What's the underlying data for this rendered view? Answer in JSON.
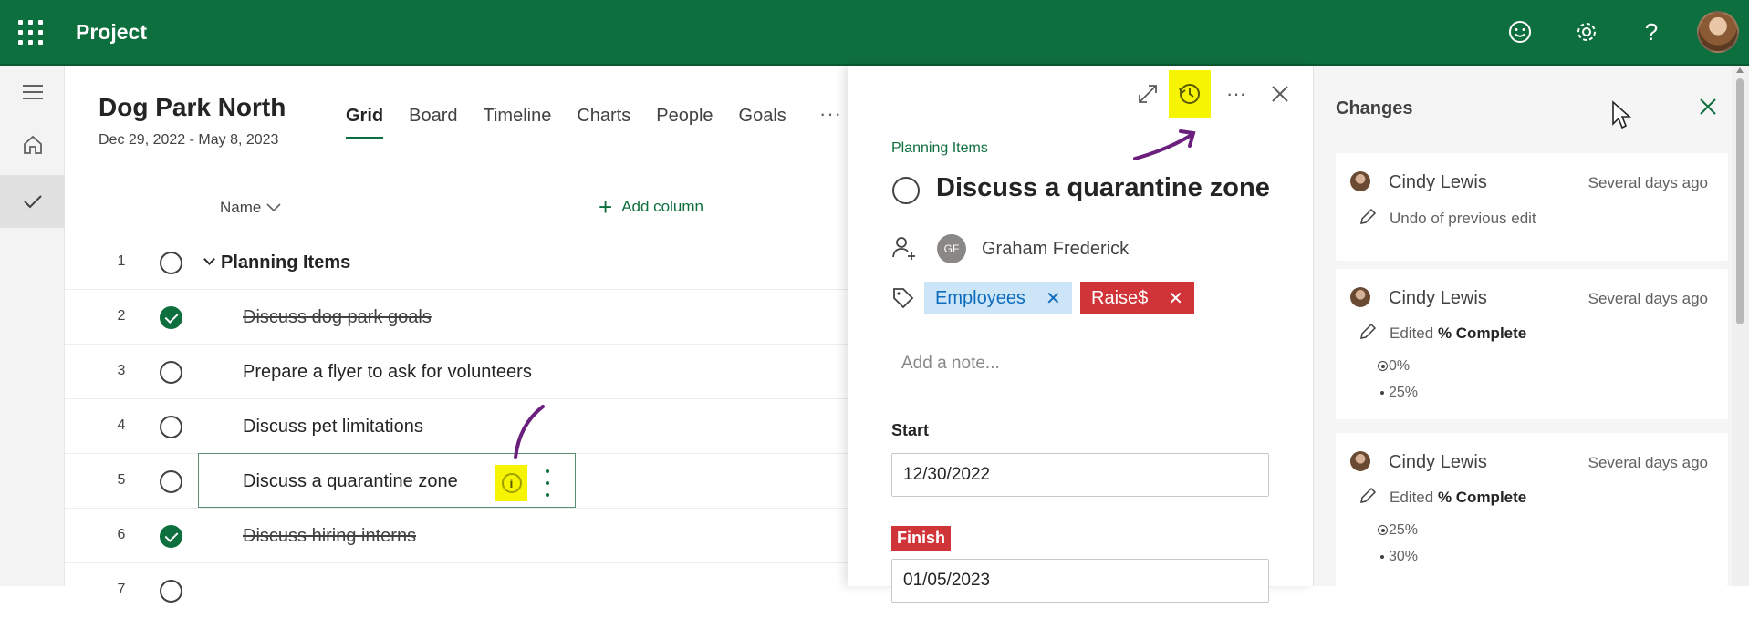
{
  "app": {
    "title": "Project"
  },
  "header_icons": [
    "smiley-icon",
    "gear-icon",
    "help-icon",
    "user-avatar"
  ],
  "help_glyph": "?",
  "project": {
    "name": "Dog Park North",
    "dates": "Dec 29, 2022 - May 8, 2023",
    "tabs": [
      {
        "label": "Grid",
        "active": true
      },
      {
        "label": "Board"
      },
      {
        "label": "Timeline"
      },
      {
        "label": "Charts"
      },
      {
        "label": "People"
      },
      {
        "label": "Goals"
      }
    ],
    "more": "···"
  },
  "grid": {
    "name_header": "Name",
    "add_column": "Add column",
    "rows": [
      {
        "num": "1",
        "task": "Planning Items",
        "bucket": true
      },
      {
        "num": "2",
        "task": "Discuss dog park goals",
        "done": true
      },
      {
        "num": "3",
        "task": "Prepare a flyer to ask for volunteers"
      },
      {
        "num": "4",
        "task": "Discuss pet limitations"
      },
      {
        "num": "5",
        "task": "Discuss a quarantine zone",
        "selected": true
      },
      {
        "num": "6",
        "task": "Discuss hiring interns",
        "done": true
      },
      {
        "num": "7",
        "task": ""
      }
    ]
  },
  "detail": {
    "bucket": "Planning Items",
    "title": "Discuss a quarantine zone",
    "assignee": {
      "initials": "GF",
      "name": "Graham Frederick"
    },
    "labels": [
      {
        "text": "Employees",
        "color": "#cde6f7"
      },
      {
        "text": "Raise$",
        "color": "#d13438"
      }
    ],
    "note_placeholder": "Add a note...",
    "start_label": "Start",
    "start_value": "12/30/2022",
    "finish_label": "Finish",
    "finish_value": "01/05/2023"
  },
  "changes": {
    "title": "Changes",
    "entries": [
      {
        "who": "Cindy Lewis",
        "when": "Several days ago",
        "action": "Undo of previous edit"
      },
      {
        "who": "Cindy Lewis",
        "when": "Several days ago",
        "action_prefix": "Edited",
        "field": "% Complete",
        "old": "0%",
        "new": "25%"
      },
      {
        "who": "Cindy Lewis",
        "when": "Several days ago",
        "action_prefix": "Edited",
        "field": "% Complete",
        "old": "25%",
        "new": "30%"
      }
    ]
  },
  "colors": {
    "brand": "#0e6f3e",
    "highlight": "#f6f400",
    "annotation": "#6b1f7c",
    "label_red": "#d13438"
  }
}
